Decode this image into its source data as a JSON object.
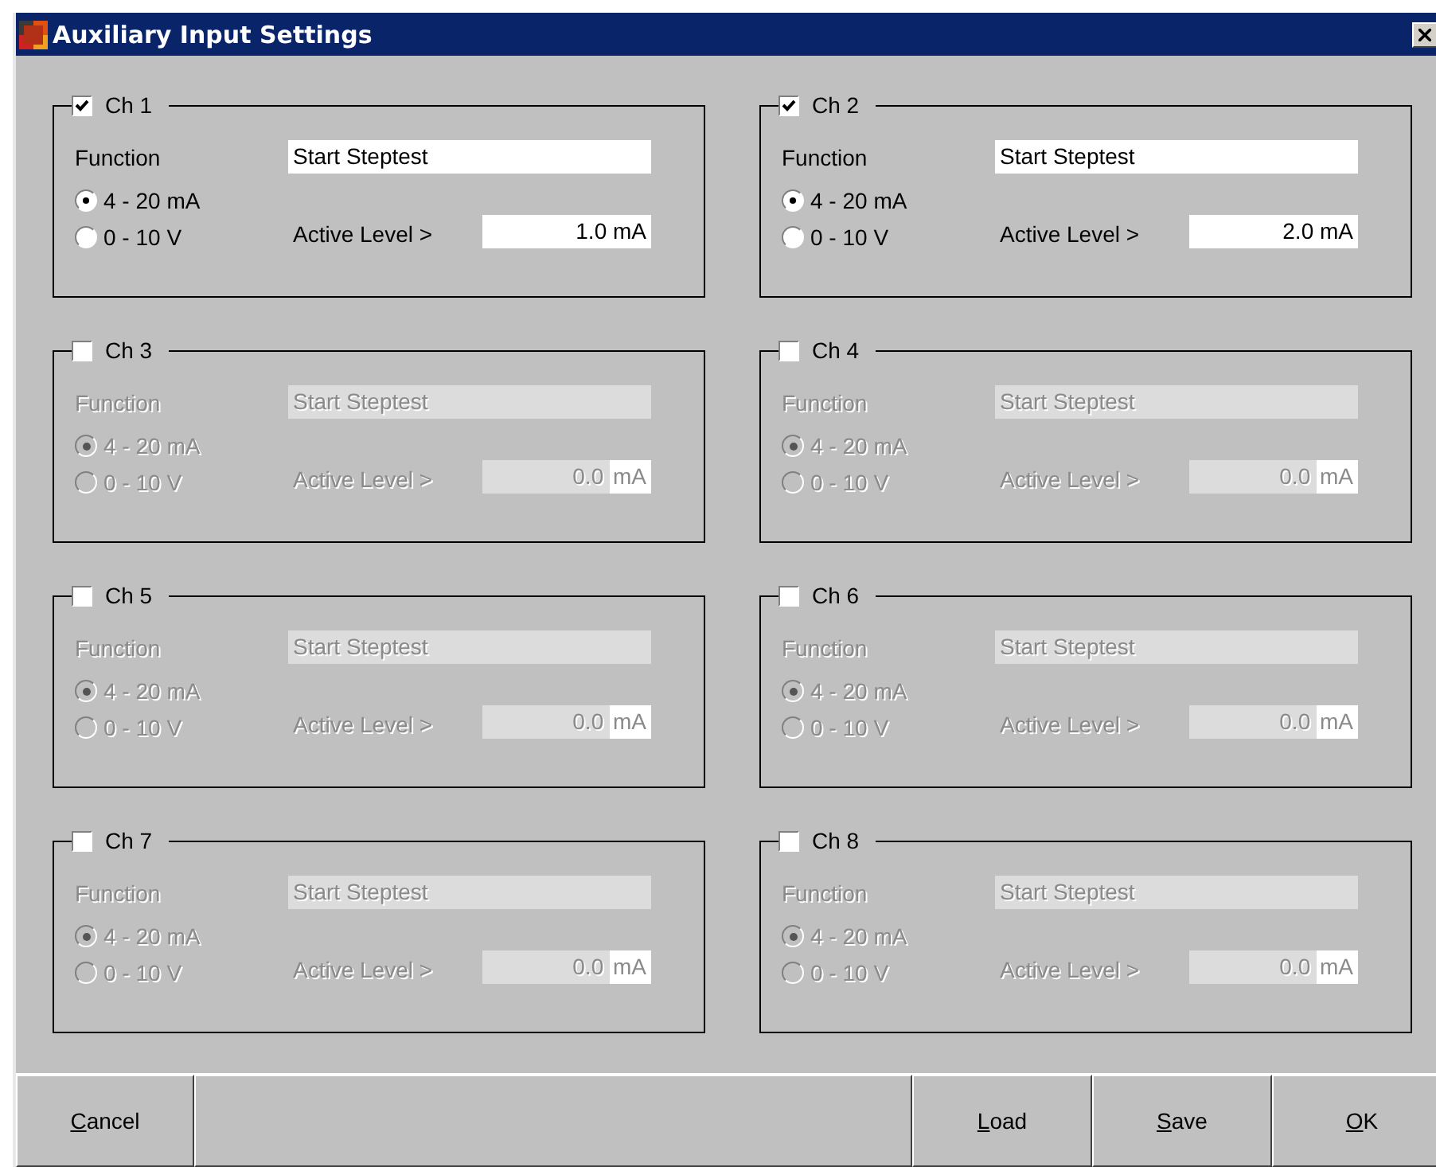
{
  "window": {
    "title": "Auxiliary Input Settings"
  },
  "channels": [
    {
      "label": "Ch 1",
      "checked": true,
      "function_label": "Function",
      "function_value": "Start Steptest",
      "options": [
        {
          "label": "4 - 20 mA",
          "selected": true
        },
        {
          "label": "0 - 10 V",
          "selected": false
        }
      ],
      "level_label": "Active Level >",
      "level_value": "1.0",
      "unit": "mA"
    },
    {
      "label": "Ch 2",
      "checked": true,
      "function_label": "Function",
      "function_value": "Start Steptest",
      "options": [
        {
          "label": "4 - 20 mA",
          "selected": true
        },
        {
          "label": "0 - 10 V",
          "selected": false
        }
      ],
      "level_label": "Active Level >",
      "level_value": "2.0",
      "unit": "mA"
    },
    {
      "label": "Ch 3",
      "checked": false,
      "function_label": "Function",
      "function_value": "Start Steptest",
      "options": [
        {
          "label": "4 - 20 mA",
          "selected": true
        },
        {
          "label": "0 - 10 V",
          "selected": false
        }
      ],
      "level_label": "Active Level >",
      "level_value": "0.0",
      "unit": "mA"
    },
    {
      "label": "Ch 4",
      "checked": false,
      "function_label": "Function",
      "function_value": "Start Steptest",
      "options": [
        {
          "label": "4 - 20 mA",
          "selected": true
        },
        {
          "label": "0 - 10 V",
          "selected": false
        }
      ],
      "level_label": "Active Level >",
      "level_value": "0.0",
      "unit": "mA"
    },
    {
      "label": "Ch 5",
      "checked": false,
      "function_label": "Function",
      "function_value": "Start Steptest",
      "options": [
        {
          "label": "4 - 20 mA",
          "selected": true
        },
        {
          "label": "0 - 10 V",
          "selected": false
        }
      ],
      "level_label": "Active Level >",
      "level_value": "0.0",
      "unit": "mA"
    },
    {
      "label": "Ch 6",
      "checked": false,
      "function_label": "Function",
      "function_value": "Start Steptest",
      "options": [
        {
          "label": "4 - 20 mA",
          "selected": true
        },
        {
          "label": "0 - 10 V",
          "selected": false
        }
      ],
      "level_label": "Active Level >",
      "level_value": "0.0",
      "unit": "mA"
    },
    {
      "label": "Ch 7",
      "checked": false,
      "function_label": "Function",
      "function_value": "Start Steptest",
      "options": [
        {
          "label": "4 - 20 mA",
          "selected": true
        },
        {
          "label": "0 - 10 V",
          "selected": false
        }
      ],
      "level_label": "Active Level >",
      "level_value": "0.0",
      "unit": "mA"
    },
    {
      "label": "Ch 8",
      "checked": false,
      "function_label": "Function",
      "function_value": "Start Steptest",
      "options": [
        {
          "label": "4 - 20 mA",
          "selected": true
        },
        {
          "label": "0 - 10 V",
          "selected": false
        }
      ],
      "level_label": "Active Level >",
      "level_value": "0.0",
      "unit": "mA"
    }
  ],
  "buttons": [
    {
      "label": "Cancel"
    },
    {
      "label": "Load"
    },
    {
      "label": "Save"
    },
    {
      "label": "OK"
    }
  ]
}
